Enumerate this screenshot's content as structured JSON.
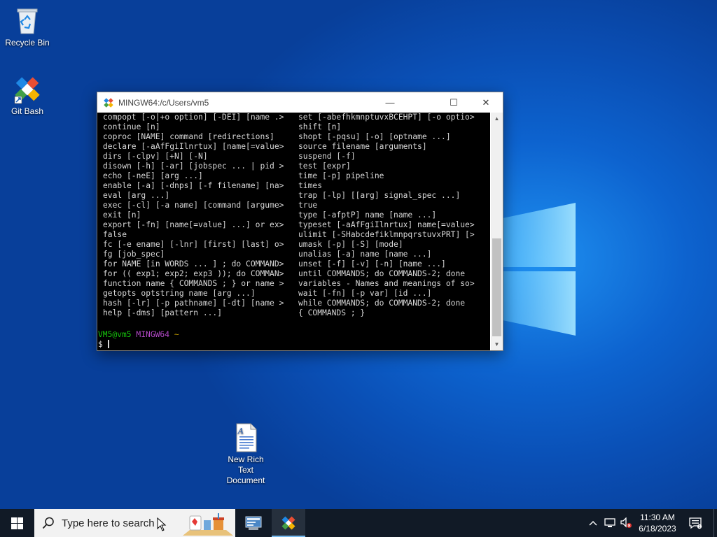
{
  "desktop": {
    "icons": [
      {
        "label": "Recycle Bin"
      },
      {
        "label": "Git Bash"
      },
      {
        "label": "New Rich Text Document"
      }
    ]
  },
  "window": {
    "title": "MINGW64:/c/Users/vm5",
    "minimize": "—",
    "maximize": "☐",
    "close": "✕"
  },
  "terminal": {
    "left_column": [
      "compopt [-o|+o option] [-DEI] [name .>",
      "continue [n]",
      "coproc [NAME] command [redirections]",
      "declare [-aAfFgiIlnrtux] [name[=value>",
      "dirs [-clpv] [+N] [-N]",
      "disown [-h] [-ar] [jobspec ... | pid >",
      "echo [-neE] [arg ...]",
      "enable [-a] [-dnps] [-f filename] [na>",
      "eval [arg ...]",
      "exec [-cl] [-a name] [command [argume>",
      "exit [n]",
      "export [-fn] [name[=value] ...] or ex>",
      "false",
      "fc [-e ename] [-lnr] [first] [last] o>",
      "fg [job_spec]",
      "for NAME [in WORDS ... ] ; do COMMAND>",
      "for (( exp1; exp2; exp3 )); do COMMAN>",
      "function name { COMMANDS ; } or name >",
      "getopts optstring name [arg ...]",
      "hash [-lr] [-p pathname] [-dt] [name >",
      "help [-dms] [pattern ...]"
    ],
    "right_column": [
      "set [-abefhkmnptuvxBCEHPT] [-o optio>",
      "shift [n]",
      "shopt [-pqsu] [-o] [optname ...]",
      "source filename [arguments]",
      "suspend [-f]",
      "test [expr]",
      "time [-p] pipeline",
      "times",
      "trap [-lp] [[arg] signal_spec ...]",
      "true",
      "type [-afptP] name [name ...]",
      "typeset [-aAfFgiIlnrtux] name[=value>",
      "ulimit [-SHabcdefiklmnpqrstuvxPRT] [>",
      "umask [-p] [-S] [mode]",
      "unalias [-a] name [name ...]",
      "unset [-f] [-v] [-n] [name ...]",
      "until COMMANDS; do COMMANDS-2; done",
      "variables - Names and meanings of so>",
      "wait [-fn] [-p var] [id ...]",
      "while COMMANDS; do COMMANDS-2; done",
      "{ COMMANDS ; }"
    ],
    "prompt_user": "VM5@vm5",
    "prompt_env": "MINGW64",
    "prompt_path": "~",
    "prompt_symbol": "$"
  },
  "taskbar": {
    "search_placeholder": "Type here to search",
    "time": "11:30 AM",
    "date": "6/18/2023"
  },
  "colors": {
    "prompt_user": "#16c60c",
    "prompt_env": "#b148c6",
    "prompt_path": "#c19c00"
  }
}
